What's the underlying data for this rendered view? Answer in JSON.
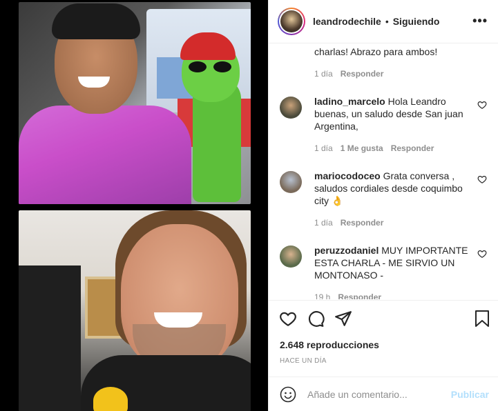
{
  "header": {
    "username": "leandrodechile",
    "separator": "•",
    "follow_status": "Siguiendo",
    "more_glyph": "•••"
  },
  "comments": [
    {
      "username": "",
      "text": "charlas! Abrazo para ambos!",
      "time": "1 día",
      "likes": "",
      "reply": "Responder",
      "avatar_color": ""
    },
    {
      "username": "ladino_marcelo",
      "text": "Hola Leandro buenas, un saludo desde San juan Argentina,",
      "time": "1 día",
      "likes": "1 Me gusta",
      "reply": "Responder",
      "avatar_color": "#4a4a3a"
    },
    {
      "username": "mariocodoceo",
      "text": "Grata conversa , saludos cordiales desde coquimbo city 👌",
      "time": "1 día",
      "likes": "",
      "reply": "Responder",
      "avatar_color": "#7a6a5a"
    },
    {
      "username": "peruzzodaniel",
      "text": "MUY IMPORTANTE ESTA CHARLA - ME SIRVIO UN MONTONASO -",
      "time": "19 h",
      "likes": "",
      "reply": "Responder",
      "avatar_color": "#5a6a4a"
    }
  ],
  "stats": {
    "views": "2.648 reproducciones",
    "time_ago": "Hace un día"
  },
  "composer": {
    "placeholder": "Añade un comentario...",
    "publish_label": "Publicar"
  },
  "icons": [
    "heart-icon",
    "comment-icon",
    "share-icon",
    "bookmark-icon",
    "emoji-icon",
    "more-icon"
  ]
}
